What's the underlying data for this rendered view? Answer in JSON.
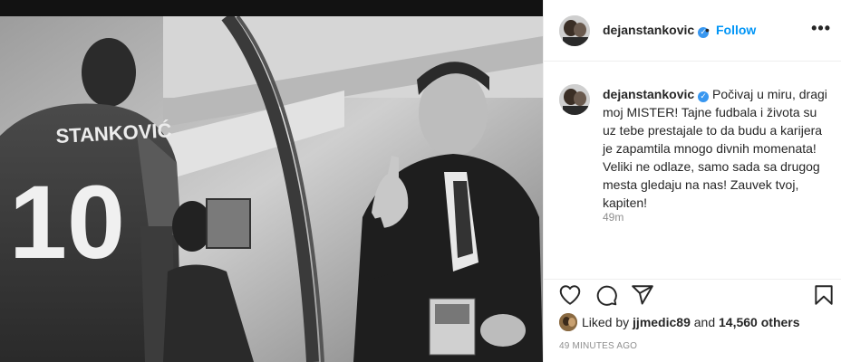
{
  "post": {
    "username": "dejanstankovic",
    "verified_icon": "verified-badge-icon",
    "follow_separator": "•",
    "follow_label": "Follow",
    "more_icon": "more-options-icon",
    "more_label": "•••",
    "caption": "Počivaj u miru, dragi moj MISTER! Tajne fudbala i života su uz tebe prestajale to da budu a karijera je zapamtila mnogo divnih momenata! Veliki ne odlaze, samo sada sa drugog mesta gledaju na nas! Zauvek tvoj, kapiten!",
    "caption_time": "49m"
  },
  "photo": {
    "jersey_name": "STANKOVIĆ",
    "jersey_number": "10"
  },
  "actions": {
    "like_icon": "heart-icon",
    "comment_icon": "comment-icon",
    "share_icon": "share-icon",
    "save_icon": "bookmark-icon"
  },
  "likes": {
    "prefix": "Liked by",
    "user": "jjmedic89",
    "conjunction": "and",
    "count": "14,560 others"
  },
  "timestamp": "49 MINUTES AGO",
  "colors": {
    "link_blue": "#0095f6",
    "verified_blue": "#3897f0",
    "text": "#262626",
    "muted": "#8e8e8e"
  }
}
